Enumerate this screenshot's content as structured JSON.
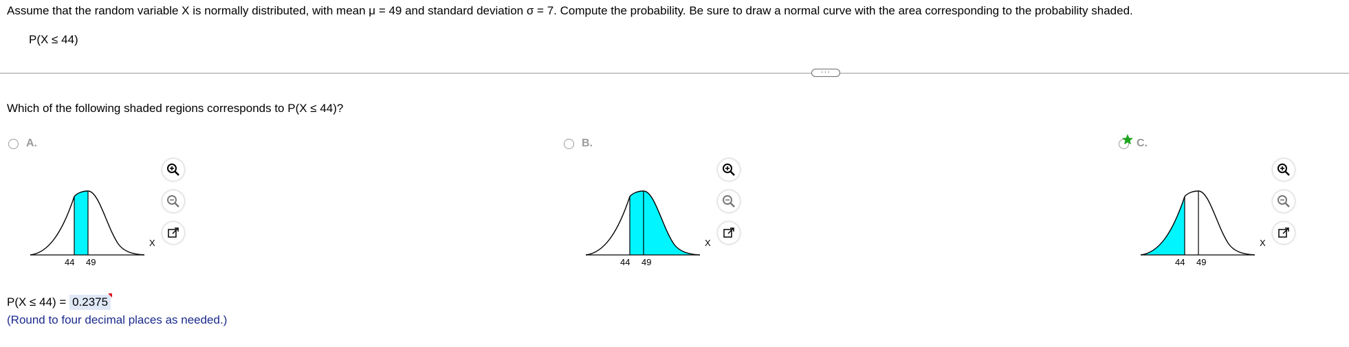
{
  "question": {
    "text": "Assume that the random variable X is normally distributed, with mean μ = 49 and standard deviation σ = 7. Compute the probability. Be sure to draw a normal curve with the area corresponding to the probability shaded.",
    "expression": "P(X ≤ 44)"
  },
  "more_button": {
    "label": "···"
  },
  "prompt": "Which of the following shaded regions corresponds to P(X ≤ 44)?",
  "options": [
    {
      "letter": "A.",
      "ticks": [
        "44",
        "49"
      ],
      "axis_label": "X",
      "shading": "between 44 and 49",
      "selected": false
    },
    {
      "letter": "B.",
      "ticks": [
        "44",
        "49"
      ],
      "axis_label": "X",
      "shading": "at or above 44",
      "selected": false
    },
    {
      "letter": "C.",
      "ticks": [
        "44",
        "49"
      ],
      "axis_label": "X",
      "shading": "at or below 44",
      "selected": false,
      "marked_correct": true
    }
  ],
  "colors": {
    "shade": "#00f5ff",
    "correct_star": "#1ea51e",
    "flag": "#d8141c",
    "note": "#1a2a8c",
    "answer_bg": "#dfe8f6"
  },
  "tool_icons": [
    "zoom-in-icon",
    "zoom-out-icon",
    "open-window-icon"
  ],
  "answer": {
    "label": "P(X ≤ 44) =",
    "value": "0.2375"
  },
  "note": "(Round to four decimal places as needed.)"
}
